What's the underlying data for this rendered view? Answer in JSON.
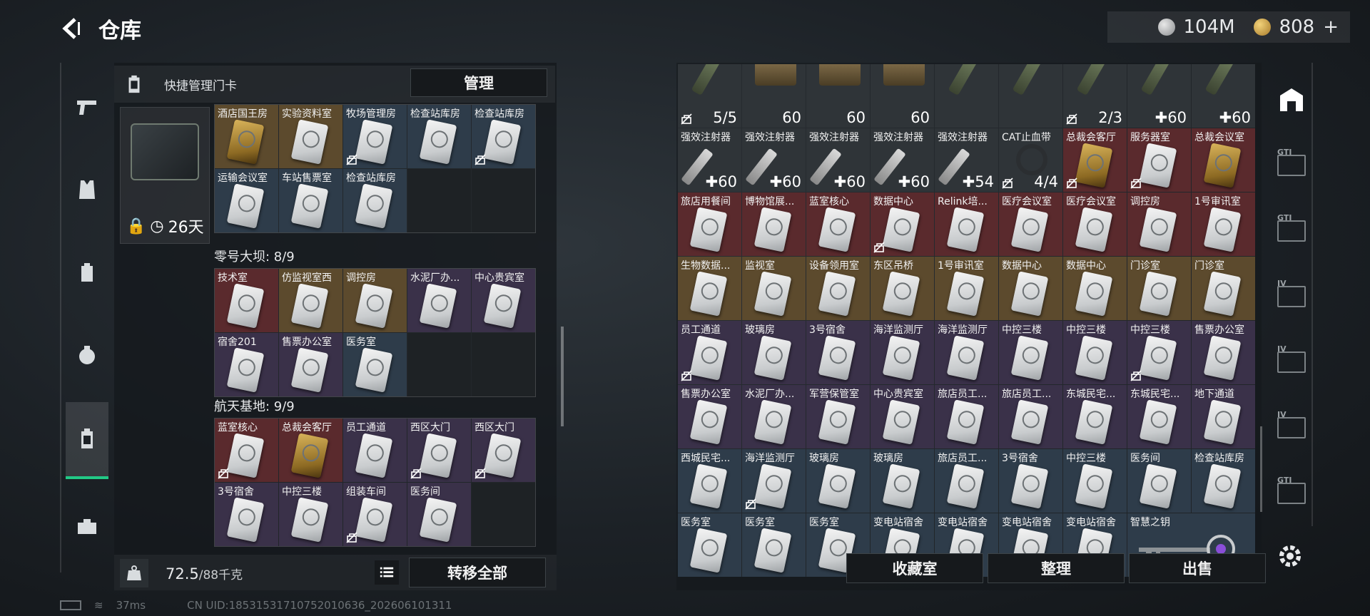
{
  "header": {
    "title": "仓库",
    "silver": "104M",
    "gold": "808",
    "gold_plus": "+"
  },
  "left_panel": {
    "header_label": "快捷管理门卡",
    "manage_label": "管理",
    "case_days": "26天",
    "sections": [
      {
        "title": "",
        "rows": 2,
        "cards": [
          {
            "name": "酒店国王房",
            "bg": "bg-gold",
            "gold": true
          },
          {
            "name": "实验资料室",
            "bg": "bg-gold"
          },
          {
            "name": "牧场管理房",
            "bg": "bg-blue",
            "nolock": true
          },
          {
            "name": "检查站库房",
            "bg": "bg-blue"
          },
          {
            "name": "检查站库房",
            "bg": "bg-blue",
            "nolock": true
          },
          {
            "name": "运输会议室",
            "bg": "bg-blue"
          },
          {
            "name": "车站售票室",
            "bg": "bg-blue"
          },
          {
            "name": "检查站库房",
            "bg": "bg-blue"
          },
          {
            "name": "",
            "bg": "bg-empty",
            "empty": true
          },
          {
            "name": "",
            "bg": "bg-empty",
            "empty": true
          }
        ]
      },
      {
        "title": "零号大坝: 8/9",
        "cards": [
          {
            "name": "技术室",
            "bg": "bg-red"
          },
          {
            "name": "仿监视室西",
            "bg": "bg-gold"
          },
          {
            "name": "调控房",
            "bg": "bg-gold"
          },
          {
            "name": "水泥厂办...",
            "bg": "bg-purple"
          },
          {
            "name": "中心贵宾室",
            "bg": "bg-purple"
          },
          {
            "name": "宿舍201",
            "bg": "bg-purple"
          },
          {
            "name": "售票办公室",
            "bg": "bg-purple"
          },
          {
            "name": "医务室",
            "bg": "bg-blue"
          },
          {
            "name": "",
            "bg": "bg-empty",
            "empty": true
          },
          {
            "name": "",
            "bg": "bg-empty",
            "empty": true
          }
        ]
      },
      {
        "title": "航天基地: 9/9",
        "cards": [
          {
            "name": "蓝室核心",
            "bg": "bg-red",
            "nolock": true
          },
          {
            "name": "总裁会客厅",
            "bg": "bg-red",
            "gold": true
          },
          {
            "name": "员工通道",
            "bg": "bg-purple"
          },
          {
            "name": "西区大门",
            "bg": "bg-purple",
            "nolock": true
          },
          {
            "name": "西区大门",
            "bg": "bg-purple",
            "nolock": true
          },
          {
            "name": "3号宿舍",
            "bg": "bg-purple"
          },
          {
            "name": "中控三楼",
            "bg": "bg-purple"
          },
          {
            "name": "组装车间",
            "bg": "bg-purple",
            "nolock": true
          },
          {
            "name": "医务间",
            "bg": "bg-purple"
          },
          {
            "name": "",
            "bg": "bg-empty",
            "empty": true
          }
        ]
      }
    ],
    "weight_value": "72.5",
    "weight_max": "/88千克",
    "transfer_label": "转移全部"
  },
  "status_bar": {
    "ping": "37ms",
    "uid": "CN UID:18531531710752010636_202606101311"
  },
  "right_panel": {
    "cards": [
      {
        "name": "",
        "count": "5/5",
        "type": "tool",
        "nolock": true,
        "bg": "bg-gray"
      },
      {
        "name": "",
        "count": "60",
        "type": "ammo",
        "bg": "bg-gray"
      },
      {
        "name": "",
        "count": "60",
        "type": "ammo",
        "bg": "bg-gray"
      },
      {
        "name": "",
        "count": "60",
        "type": "ammo",
        "bg": "bg-gray"
      },
      {
        "name": "",
        "count": "",
        "type": "tool",
        "bg": "bg-gray"
      },
      {
        "name": "",
        "count": "",
        "type": "tool",
        "bg": "bg-gray"
      },
      {
        "name": "",
        "count": "2/3",
        "type": "tool",
        "nolock": true,
        "bg": "bg-gray"
      },
      {
        "name": "",
        "count": "✚60",
        "type": "tool",
        "bg": "bg-gray"
      },
      {
        "name": "",
        "count": "✚60",
        "type": "tool",
        "bg": "bg-gray"
      },
      {
        "name": "强效注射器",
        "count": "✚60",
        "type": "syringe",
        "bg": "bg-gray"
      },
      {
        "name": "强效注射器",
        "count": "✚60",
        "type": "syringe",
        "bg": "bg-gray"
      },
      {
        "name": "强效注射器",
        "count": "✚60",
        "type": "syringe",
        "bg": "bg-gray"
      },
      {
        "name": "强效注射器",
        "count": "✚60",
        "type": "syringe",
        "bg": "bg-gray"
      },
      {
        "name": "强效注射器",
        "count": "✚54",
        "type": "syringe",
        "bg": "bg-gray"
      },
      {
        "name": "CAT止血带",
        "count": "4/4",
        "type": "tourniquet",
        "nolock": true,
        "bg": "bg-gray"
      },
      {
        "name": "总裁会客厅",
        "count": "",
        "type": "card",
        "gold": true,
        "nolock": true,
        "bg": "bg-red"
      },
      {
        "name": "服务器室",
        "count": "",
        "type": "card",
        "nolock": true,
        "bg": "bg-red"
      },
      {
        "name": "总裁会议室",
        "count": "",
        "type": "card",
        "gold": true,
        "bg": "bg-red"
      },
      {
        "name": "旅店用餐间",
        "count": "",
        "type": "card",
        "bg": "bg-red"
      },
      {
        "name": "博物馆展...",
        "count": "",
        "type": "card",
        "bg": "bg-red"
      },
      {
        "name": "蓝室核心",
        "count": "",
        "type": "card",
        "bg": "bg-red"
      },
      {
        "name": "数据中心",
        "count": "",
        "type": "card",
        "nolock": true,
        "bg": "bg-red"
      },
      {
        "name": "Relink培...",
        "count": "",
        "type": "card",
        "bg": "bg-red"
      },
      {
        "name": "医疗会议室",
        "count": "",
        "type": "card",
        "bg": "bg-red"
      },
      {
        "name": "医疗会议室",
        "count": "",
        "type": "card",
        "bg": "bg-red"
      },
      {
        "name": "调控房",
        "count": "",
        "type": "card",
        "bg": "bg-red"
      },
      {
        "name": "1号审讯室",
        "count": "",
        "type": "card",
        "bg": "bg-red"
      },
      {
        "name": "生物数据...",
        "count": "",
        "type": "card",
        "bg": "bg-gold"
      },
      {
        "name": "监视室",
        "count": "",
        "type": "card",
        "bg": "bg-gold"
      },
      {
        "name": "设备领用室",
        "count": "",
        "type": "card",
        "bg": "bg-gold"
      },
      {
        "name": "东区吊桥",
        "count": "",
        "type": "card",
        "bg": "bg-gold"
      },
      {
        "name": "1号审讯室",
        "count": "",
        "type": "card",
        "bg": "bg-gold"
      },
      {
        "name": "数据中心",
        "count": "",
        "type": "card",
        "bg": "bg-gold"
      },
      {
        "name": "数据中心",
        "count": "",
        "type": "card",
        "bg": "bg-gold"
      },
      {
        "name": "门诊室",
        "count": "",
        "type": "card",
        "bg": "bg-gold"
      },
      {
        "name": "门诊室",
        "count": "",
        "type": "card",
        "bg": "bg-gold"
      },
      {
        "name": "员工通道",
        "count": "",
        "type": "card",
        "nolock": true,
        "bg": "bg-purple"
      },
      {
        "name": "玻璃房",
        "count": "",
        "type": "card",
        "bg": "bg-purple"
      },
      {
        "name": "3号宿舍",
        "count": "",
        "type": "card",
        "bg": "bg-purple"
      },
      {
        "name": "海洋监测厅",
        "count": "",
        "type": "card",
        "bg": "bg-purple"
      },
      {
        "name": "海洋监测厅",
        "count": "",
        "type": "card",
        "bg": "bg-purple"
      },
      {
        "name": "中控三楼",
        "count": "",
        "type": "card",
        "bg": "bg-purple"
      },
      {
        "name": "中控三楼",
        "count": "",
        "type": "card",
        "bg": "bg-purple"
      },
      {
        "name": "中控三楼",
        "count": "",
        "type": "card",
        "nolock": true,
        "bg": "bg-purple"
      },
      {
        "name": "售票办公室",
        "count": "",
        "type": "card",
        "bg": "bg-purple"
      },
      {
        "name": "售票办公室",
        "count": "",
        "type": "card",
        "bg": "bg-purple"
      },
      {
        "name": "水泥厂办...",
        "count": "",
        "type": "card",
        "bg": "bg-purple"
      },
      {
        "name": "军营保管室",
        "count": "",
        "type": "card",
        "bg": "bg-purple"
      },
      {
        "name": "中心贵宾室",
        "count": "",
        "type": "card",
        "bg": "bg-purple"
      },
      {
        "name": "旅店员工...",
        "count": "",
        "type": "card",
        "bg": "bg-purple"
      },
      {
        "name": "旅店员工...",
        "count": "",
        "type": "card",
        "bg": "bg-purple"
      },
      {
        "name": "东城民宅...",
        "count": "",
        "type": "card",
        "bg": "bg-purple"
      },
      {
        "name": "东城民宅...",
        "count": "",
        "type": "card",
        "bg": "bg-purple"
      },
      {
        "name": "地下通道",
        "count": "",
        "type": "card",
        "bg": "bg-purple"
      },
      {
        "name": "西城民宅...",
        "count": "",
        "type": "card",
        "bg": "bg-blue"
      },
      {
        "name": "海洋监测厅",
        "count": "",
        "type": "card",
        "nolock": true,
        "bg": "bg-blue"
      },
      {
        "name": "玻璃房",
        "count": "",
        "type": "card",
        "bg": "bg-blue"
      },
      {
        "name": "玻璃房",
        "count": "",
        "type": "card",
        "bg": "bg-blue"
      },
      {
        "name": "旅店员工...",
        "count": "",
        "type": "card",
        "bg": "bg-blue"
      },
      {
        "name": "3号宿舍",
        "count": "",
        "type": "card",
        "bg": "bg-blue"
      },
      {
        "name": "中控三楼",
        "count": "",
        "type": "card",
        "bg": "bg-blue"
      },
      {
        "name": "医务间",
        "count": "",
        "type": "card",
        "bg": "bg-blue"
      },
      {
        "name": "检查站库房",
        "count": "",
        "type": "card",
        "bg": "bg-blue"
      },
      {
        "name": "医务室",
        "count": "",
        "type": "card",
        "bg": "bg-blue"
      },
      {
        "name": "医务室",
        "count": "",
        "type": "card",
        "bg": "bg-blue"
      },
      {
        "name": "医务室",
        "count": "",
        "type": "card",
        "bg": "bg-blue"
      },
      {
        "name": "变电站宿舍",
        "count": "",
        "type": "card",
        "bg": "bg-blue"
      },
      {
        "name": "变电站宿舍",
        "count": "",
        "type": "card",
        "bg": "bg-blue"
      },
      {
        "name": "变电站宿舍",
        "count": "",
        "type": "card",
        "bg": "bg-blue"
      },
      {
        "name": "变电站宿舍",
        "count": "",
        "type": "card",
        "bg": "bg-blue"
      },
      {
        "name": "智慧之钥",
        "count": "",
        "type": "key",
        "bg": "bg-blue",
        "span": 2
      }
    ],
    "footer_buttons": [
      "收藏室",
      "整理",
      "出售"
    ]
  },
  "right_nav": [
    {
      "icon": "base-icon",
      "label": ""
    },
    {
      "icon": "case-gti-icon",
      "label": "GTI"
    },
    {
      "icon": "rig-gti-icon",
      "label": "GTI"
    },
    {
      "icon": "case-iv-icon",
      "label": "IV"
    },
    {
      "icon": "case-iv-plus-icon",
      "label": "IV"
    },
    {
      "icon": "case-iv-safe-icon",
      "label": "IV"
    },
    {
      "icon": "case-gti-small-icon",
      "label": "GTI"
    }
  ]
}
